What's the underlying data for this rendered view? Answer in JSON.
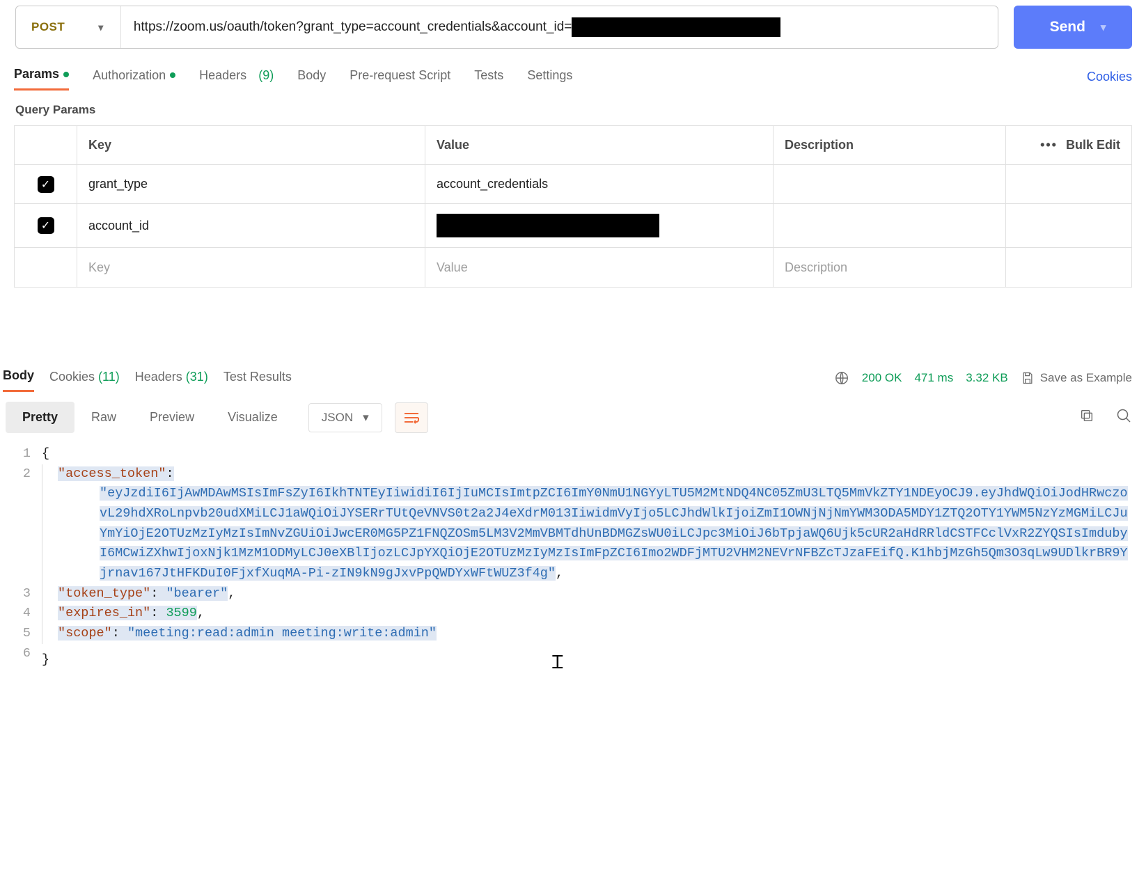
{
  "request": {
    "method": "POST",
    "url_prefix": "https://zoom.us/oauth/token?grant_type=account_credentials&account_id=",
    "url_redacted_suffix": true,
    "send_label": "Send"
  },
  "request_tabs": [
    {
      "label": "Params",
      "active": true,
      "dot": true
    },
    {
      "label": "Authorization",
      "active": false,
      "dot": true
    },
    {
      "label": "Headers",
      "active": false,
      "count": "(9)"
    },
    {
      "label": "Body",
      "active": false
    },
    {
      "label": "Pre-request Script",
      "active": false
    },
    {
      "label": "Tests",
      "active": false
    },
    {
      "label": "Settings",
      "active": false
    }
  ],
  "cookies_link": "Cookies",
  "section_heading": "Query Params",
  "params_table": {
    "headers": {
      "key": "Key",
      "value": "Value",
      "description": "Description"
    },
    "actions": {
      "dots": "•••",
      "bulk": "Bulk Edit"
    },
    "rows": [
      {
        "checked": true,
        "key": "grant_type",
        "value": "account_credentials",
        "value_redacted": false
      },
      {
        "checked": true,
        "key": "account_id",
        "value": "",
        "value_redacted": true
      }
    ],
    "placeholder": {
      "key": "Key",
      "value": "Value",
      "description": "Description"
    }
  },
  "response_tabs": [
    {
      "label": "Body",
      "active": true
    },
    {
      "label": "Cookies",
      "count": "(11)"
    },
    {
      "label": "Headers",
      "count": "(31)"
    },
    {
      "label": "Test Results"
    }
  ],
  "response_meta": {
    "status": "200 OK",
    "time": "471 ms",
    "size": "3.32 KB",
    "save_label": "Save as Example"
  },
  "view_tabs": [
    {
      "label": "Pretty",
      "active": true
    },
    {
      "label": "Raw"
    },
    {
      "label": "Preview"
    },
    {
      "label": "Visualize"
    }
  ],
  "format_select": "JSON",
  "json_body": {
    "access_token_key": "\"access_token\"",
    "access_token_value": "\"eyJzdiI6IjAwMDAwMSIsImFsZyI6IkhTNTEyIiwidiI6IjIuMCIsImtpZCI6ImY0NmU1NGYyLTU5M2MtNDQ4NC05ZmU3LTQ5MmVkZTY1NDEyOCJ9.eyJhdWQiOiJodHRwczovL29hdXRoLnpvb20udXMiLCJ1aWQiOiJYSERrTUtQeVNVS0t2a2J4eXdrM013IiwidmVyIjo5LCJhdWlkIjoiZmI1OWNjNjNmYWM3ODA5MDY1ZTQ2OTY1YWM5NzYzMGMiLCJuYmYiOjE2OTUzMzIyMzIsImNvZGUiOiJwcER0MG5PZ1FNQZOSm5LM3V2MmVBMTdhUnBDMGZsWU0iLCJpc3MiOiJ6bTpjaWQ6Ujk5cUR2aHdRRldCSTFCclVxR2ZYQSIsImdubyI6MCwiZXhwIjoxNjk1MzM1ODMyLCJ0eXBlIjozLCJpYXQiOjE2OTUzMzIyMzIsImFpZCI6Imo2WDFjMTU2VHM2NEVrNFBZcTJzaFEifQ.K1hbjMzGh5Qm3O3qLw9UDlkrBR9Yjrnav167JtHFKDuI0FjxfXuqMA-Pi-zIN9kN9gJxvPpQWDYxWFtWUZ3f4g\"",
    "token_type_key": "\"token_type\"",
    "token_type_value": "\"bearer\"",
    "expires_in_key": "\"expires_in\"",
    "expires_in_value": "3599",
    "scope_key": "\"scope\"",
    "scope_value": "\"meeting:read:admin meeting:write:admin\""
  }
}
